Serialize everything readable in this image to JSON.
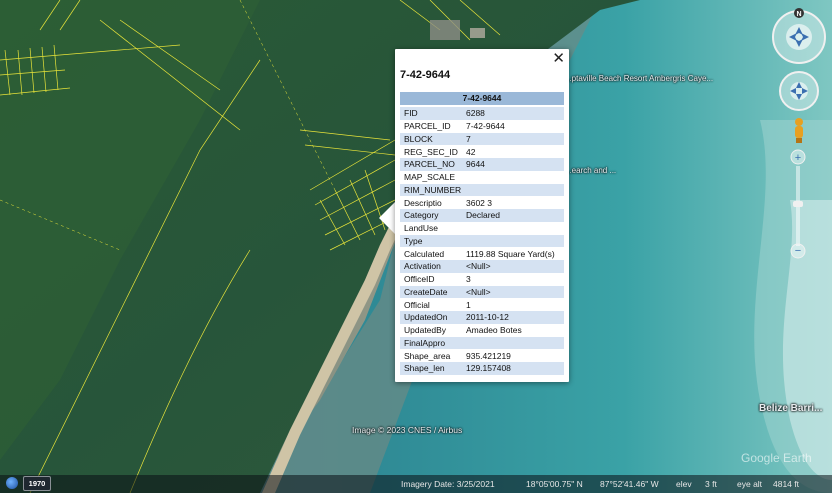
{
  "map": {
    "labels": {
      "resort": "...ptaville Beach Resort Ambergris Caye...",
      "search": "...earch and ...",
      "region": "Belize Barri...",
      "imagery_credit": "Image © 2023 CNES / Airbus",
      "watermark": "Google Earth"
    }
  },
  "popup": {
    "title": "7-42-9644",
    "close_label": "✕",
    "table_header": "7-42-9644",
    "rows": [
      {
        "key": "FID",
        "value": "6288"
      },
      {
        "key": "PARCEL_ID",
        "value": "7-42-9644"
      },
      {
        "key": "BLOCK",
        "value": "7"
      },
      {
        "key": "REG_SEC_ID",
        "value": "42"
      },
      {
        "key": "PARCEL_NO",
        "value": "9644"
      },
      {
        "key": "MAP_SCALE",
        "value": ""
      },
      {
        "key": "RIM_NUMBER",
        "value": ""
      },
      {
        "key": "Descriptio",
        "value": "3602 3"
      },
      {
        "key": "Category",
        "value": "Declared"
      },
      {
        "key": "LandUse",
        "value": ""
      },
      {
        "key": "Type",
        "value": ""
      },
      {
        "key": "Calculated",
        "value": "1119.88 Square Yard(s)"
      },
      {
        "key": "Activation",
        "value": "<Null>"
      },
      {
        "key": "OfficeID",
        "value": "3"
      },
      {
        "key": "CreateDate",
        "value": "<Null>"
      },
      {
        "key": "Official",
        "value": "1"
      },
      {
        "key": "UpdatedOn",
        "value": "2011-10-12"
      },
      {
        "key": "UpdatedBy",
        "value": "Amadeo Botes"
      },
      {
        "key": "FinalAppro",
        "value": ""
      },
      {
        "key": "Shape_area",
        "value": "935.421219"
      },
      {
        "key": "Shape_len",
        "value": "129.157408"
      }
    ]
  },
  "status_bar": {
    "historical_year": "1970",
    "imagery_date": "Imagery Date: 3/25/2021",
    "latitude": "18°05'00.75\" N",
    "longitude": "87°52'41.46\" W",
    "elevation_label": "elev",
    "elevation": "3 ft",
    "eye_alt_label": "eye alt",
    "eye_alt": "4814 ft"
  },
  "controls": {
    "compass_north": "N"
  },
  "colors": {
    "parcel_lines": "#e8e43a",
    "table_header_bg": "#9ab8d8",
    "table_alt_row": "#d5e2f2"
  }
}
